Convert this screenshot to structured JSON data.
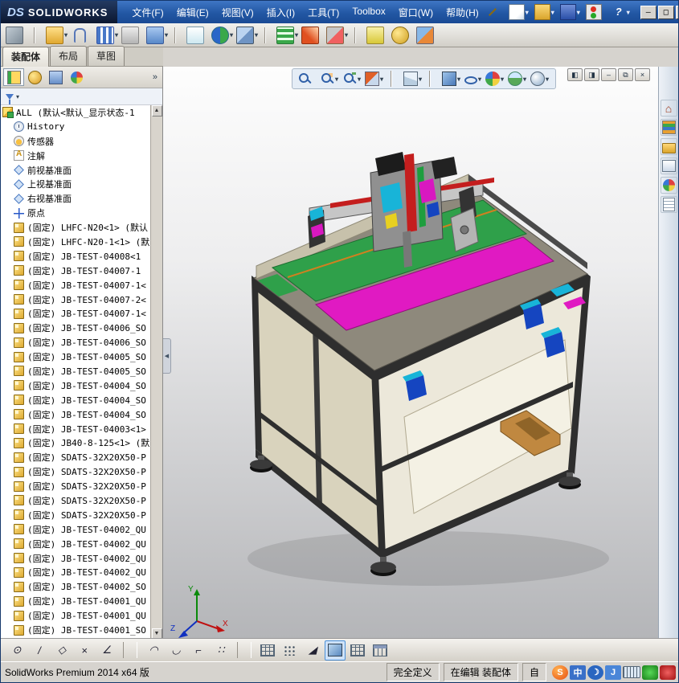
{
  "brand": {
    "ds": "DS",
    "name": "SOLIDWORKS"
  },
  "menu": {
    "items": [
      "文件(F)",
      "编辑(E)",
      "视图(V)",
      "插入(I)",
      "工具(T)",
      "Toolbox",
      "窗口(W)",
      "帮助(H)"
    ]
  },
  "titlebar_icons": [
    {
      "name": "new-document-icon",
      "caret": "▾"
    },
    {
      "name": "open-icon",
      "caret": "▾"
    },
    {
      "name": "save-icon",
      "caret": "▾"
    },
    {
      "name": "traffic-light-icon"
    },
    {
      "name": "help-icon",
      "caret": "▾"
    }
  ],
  "window_buttons": [
    {
      "name": "minimize-button",
      "glyph": "–"
    },
    {
      "name": "maximize-button",
      "glyph": "□"
    },
    {
      "name": "close-button",
      "glyph": "×"
    }
  ],
  "toolbar2": {
    "items": [
      {
        "name": "rebuild-icon"
      },
      {
        "name": "toolbar-separator"
      },
      {
        "name": "insert-components-icon",
        "caret": "▾"
      },
      {
        "name": "mate-icon"
      },
      {
        "name": "linear-pattern-icon",
        "caret": "▾"
      },
      {
        "name": "smart-fasteners-icon"
      },
      {
        "name": "move-component-icon",
        "caret": "▾"
      },
      {
        "name": "toolbar-separator"
      },
      {
        "name": "show-hidden-components-icon"
      },
      {
        "name": "assembly-features-icon",
        "caret": "▾"
      },
      {
        "name": "reference-geometry-icon",
        "caret": "▾"
      },
      {
        "name": "toolbar-separator"
      },
      {
        "name": "bom-icon",
        "caret": "▾"
      },
      {
        "name": "exploded-view-icon"
      },
      {
        "name": "interference-detection-icon",
        "caret": "▾"
      },
      {
        "name": "toolbar-separator"
      },
      {
        "name": "measure-icon"
      },
      {
        "name": "mass-properties-icon"
      },
      {
        "name": "section-tool-icon"
      }
    ]
  },
  "tabs": {
    "items": [
      {
        "label": "装配体",
        "state": "active"
      },
      {
        "label": "布局",
        "state": ""
      },
      {
        "label": "草图",
        "state": ""
      }
    ]
  },
  "panel": {
    "header_icons": [
      {
        "name": "featuremanager-tree-icon",
        "state": "active"
      },
      {
        "name": "propertymanager-icon",
        "state": ""
      },
      {
        "name": "configurationmanager-icon",
        "state": ""
      },
      {
        "name": "displaymanager-icon",
        "state": ""
      }
    ],
    "overflow_chevron": "»",
    "filter_caret": "▾",
    "collapse_glyph": "◀"
  },
  "tree": {
    "root": "ALL (默认<默认_显示状态-1",
    "items": [
      {
        "icon": "history-icon",
        "label": "History"
      },
      {
        "icon": "sensors-icon",
        "label": "传感器"
      },
      {
        "icon": "annotations-icon",
        "label": "注解"
      },
      {
        "icon": "plane-icon",
        "label": "前视基准面"
      },
      {
        "icon": "plane-icon",
        "label": "上视基准面"
      },
      {
        "icon": "plane-icon",
        "label": "右视基准面"
      },
      {
        "icon": "origin-icon",
        "label": "原点"
      },
      {
        "icon": "part-icon",
        "label": "(固定) LHFC-N20<1> (默认"
      },
      {
        "icon": "part-icon",
        "label": "(固定) LHFC-N20-1<1> (默"
      },
      {
        "icon": "part-icon",
        "label": "(固定) JB-TEST-04008<1"
      },
      {
        "icon": "part-icon",
        "label": "(固定) JB-TEST-04007-1"
      },
      {
        "icon": "part-icon",
        "label": "(固定) JB-TEST-04007-1<"
      },
      {
        "icon": "part-icon",
        "label": "(固定) JB-TEST-04007-2<"
      },
      {
        "icon": "part-icon",
        "label": "(固定) JB-TEST-04007-1<"
      },
      {
        "icon": "part-icon",
        "label": "(固定) JB-TEST-04006_SO"
      },
      {
        "icon": "part-icon",
        "label": "(固定) JB-TEST-04006_SO"
      },
      {
        "icon": "part-icon",
        "label": "(固定) JB-TEST-04005_SO"
      },
      {
        "icon": "part-icon",
        "label": "(固定) JB-TEST-04005_SO"
      },
      {
        "icon": "part-icon",
        "label": "(固定) JB-TEST-04004_SO"
      },
      {
        "icon": "part-icon",
        "label": "(固定) JB-TEST-04004_SO"
      },
      {
        "icon": "part-icon",
        "label": "(固定) JB-TEST-04004_SO"
      },
      {
        "icon": "part-icon",
        "label": "(固定) JB-TEST-04003<1>"
      },
      {
        "icon": "part-icon",
        "label": "(固定) JB40-8-125<1> (默"
      },
      {
        "icon": "part-icon",
        "label": "(固定) SDATS-32X20X50-P"
      },
      {
        "icon": "part-icon",
        "label": "(固定) SDATS-32X20X50-P"
      },
      {
        "icon": "part-icon",
        "label": "(固定) SDATS-32X20X50-P"
      },
      {
        "icon": "part-icon",
        "label": "(固定) SDATS-32X20X50-P"
      },
      {
        "icon": "part-icon",
        "label": "(固定) SDATS-32X20X50-P"
      },
      {
        "icon": "part-icon",
        "label": "(固定) JB-TEST-04002_QU"
      },
      {
        "icon": "part-icon",
        "label": "(固定) JB-TEST-04002_QU"
      },
      {
        "icon": "part-icon",
        "label": "(固定) JB-TEST-04002_QU"
      },
      {
        "icon": "part-icon",
        "label": "(固定) JB-TEST-04002_QU"
      },
      {
        "icon": "part-icon",
        "label": "(固定) JB-TEST-04002_SO"
      },
      {
        "icon": "part-icon",
        "label": "(固定) JB-TEST-04001_QU"
      },
      {
        "icon": "part-icon",
        "label": "(固定) JB-TEST-04001_QU"
      },
      {
        "icon": "part-icon",
        "label": "(固定) JB-TEST-04001_SO"
      }
    ]
  },
  "scrollbar": {
    "up": "▲",
    "down": "▼"
  },
  "viewport": {
    "hud": [
      {
        "name": "zoom-fit-icon"
      },
      {
        "name": "zoom-area-icon",
        "caret": "▾"
      },
      {
        "name": "previous-view-icon",
        "caret": "▾"
      },
      {
        "name": "section-view-icon",
        "caret": "▾"
      },
      {
        "name": "toolbar-separator"
      },
      {
        "name": "view-orientation-icon",
        "caret": "▾"
      },
      {
        "name": "toolbar-separator"
      },
      {
        "name": "display-style-icon",
        "caret": "▾"
      },
      {
        "name": "hide-show-items-icon",
        "caret": "▾"
      },
      {
        "name": "edit-appearance-icon",
        "caret": "▾"
      },
      {
        "name": "apply-scene-icon",
        "caret": "▾"
      },
      {
        "name": "view-settings-icon",
        "caret": "▾"
      }
    ],
    "doc_buttons": [
      {
        "name": "pane-left-icon",
        "glyph": "◧"
      },
      {
        "name": "pane-right-icon",
        "glyph": "◨"
      },
      {
        "name": "minimize-doc-button",
        "glyph": "–"
      },
      {
        "name": "restore-doc-button",
        "glyph": "⧉"
      },
      {
        "name": "close-doc-button",
        "glyph": "×"
      }
    ],
    "triad": {
      "x": "X",
      "y": "Y",
      "z": "Z"
    }
  },
  "taskpane": {
    "items": [
      {
        "name": "home-icon",
        "glyph": "⌂"
      },
      {
        "name": "design-library-icon"
      },
      {
        "name": "file-explorer-icon"
      },
      {
        "name": "view-palette-icon"
      },
      {
        "name": "appearances-icon"
      },
      {
        "name": "custom-properties-icon"
      }
    ]
  },
  "bottombar": {
    "items": [
      {
        "name": "centerpoint-arc-icon",
        "glyph": "⊙"
      },
      {
        "name": "line-icon",
        "glyph": "/"
      },
      {
        "name": "polygon-icon",
        "glyph": "◇"
      },
      {
        "name": "trim-icon",
        "glyph": "×"
      },
      {
        "name": "angle-icon",
        "glyph": "∠"
      },
      {
        "name": "toolbar-separator"
      },
      {
        "name": "arc-up-icon",
        "glyph": "◠"
      },
      {
        "name": "arc-down-icon",
        "glyph": "◡"
      },
      {
        "name": "corner-icon",
        "glyph": "⌐"
      },
      {
        "name": "points-icon",
        "glyph": "∷"
      },
      {
        "name": "toolbar-separator"
      },
      {
        "name": "grid-icon"
      },
      {
        "name": "pattern-icon"
      },
      {
        "name": "triangle-icon",
        "glyph": "◢"
      },
      {
        "name": "shaded-cube-icon",
        "state": "active"
      },
      {
        "name": "grid2-icon"
      },
      {
        "name": "table-icon"
      }
    ]
  },
  "statusbar": {
    "product": "SolidWorks Premium 2014 x64 版",
    "state": "完全定义",
    "editing": "在编辑 装配体",
    "custom": "自",
    "tray": [
      {
        "name": "sogou-icon",
        "glyph": "S"
      },
      {
        "name": "chinese-input-icon",
        "glyph": "中"
      },
      {
        "name": "moon-icon",
        "glyph": "☽"
      },
      {
        "name": "handwriting-icon",
        "glyph": "J"
      },
      {
        "name": "keyboard-icon"
      },
      {
        "name": "green-status-icon"
      },
      {
        "name": "red-status-icon"
      }
    ]
  },
  "palette": {
    "frame": "#2e2e2e",
    "panel_beige": "#d9d3bd",
    "panel_light": "#ece8da",
    "deck_gray": "#8e897c",
    "plate_green": "#2fa04a",
    "plate_magenta": "#e01ac2",
    "accent_cyan": "#18b4d8",
    "accent_red": "#c41e1e",
    "accent_green": "#1e9e3e",
    "accent_blue": "#1545c0",
    "accent_magenta": "#d818c0",
    "bracket_orange": "#c08840"
  }
}
